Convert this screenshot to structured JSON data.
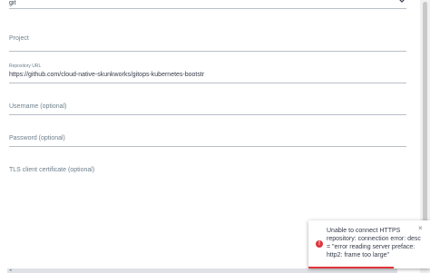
{
  "form": {
    "type_field": {
      "value": "git"
    },
    "project_field": {
      "label": "Project",
      "value": ""
    },
    "repo_url_field": {
      "label": "Repository URL",
      "value": "https://github.com/cloud-native-skunkworks/gitops-kubernetes-bootstr"
    },
    "username_field": {
      "label": "Username (optional)",
      "value": ""
    },
    "password_field": {
      "label": "Password (optional)",
      "value": ""
    },
    "tls_field": {
      "label": "TLS client certificate (optional)",
      "value": ""
    }
  },
  "toast": {
    "message": "Unable to connect HTTPS repository: connection error: desc = \"error reading server preface: http2: frame too large\"",
    "icon": "error-icon",
    "close_glyph": "×",
    "status_color": "#e0353b",
    "progress": 0.7
  },
  "icons": {
    "chevron": "chevron-down-icon",
    "scroll_left": "◂"
  }
}
